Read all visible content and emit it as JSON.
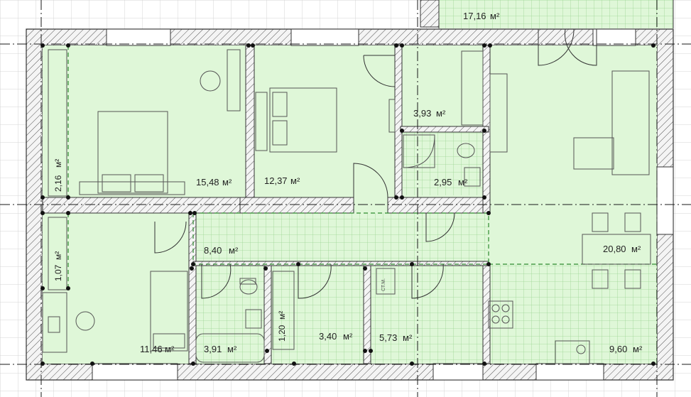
{
  "colors": {
    "room_fill": "#dff7d8",
    "tile_line": "#8fcf86",
    "wall_hatch": "#5a5a5a",
    "wall_bg": "#f6f6f6",
    "grid_line": "#cfcfcf",
    "axis_line": "#1a1a1a",
    "furniture": "#555555",
    "zone_line": "#2e8b2e"
  },
  "unit": "м²",
  "rooms": [
    {
      "id": "terrace",
      "area": "17,16"
    },
    {
      "id": "bedroom-1",
      "area": "15,48"
    },
    {
      "id": "bedroom-2",
      "area": "12,37"
    },
    {
      "id": "dressing-1",
      "area": "3,93"
    },
    {
      "id": "wc",
      "area": "2,95"
    },
    {
      "id": "closet-left-top",
      "area": "2,16"
    },
    {
      "id": "closet-left-bottom",
      "area": "1,07"
    },
    {
      "id": "hall",
      "area": "8,40"
    },
    {
      "id": "living",
      "area": "20,80"
    },
    {
      "id": "bedroom-3",
      "area": "11,46"
    },
    {
      "id": "bath",
      "area": "3,91"
    },
    {
      "id": "closet-mid",
      "area": "1,20"
    },
    {
      "id": "corridor-small",
      "area": "3,40"
    },
    {
      "id": "storage",
      "area": "5,73"
    },
    {
      "id": "kitchen",
      "area": "9,60"
    }
  ],
  "fixture_labels": {
    "boiler": "СТ.М."
  }
}
